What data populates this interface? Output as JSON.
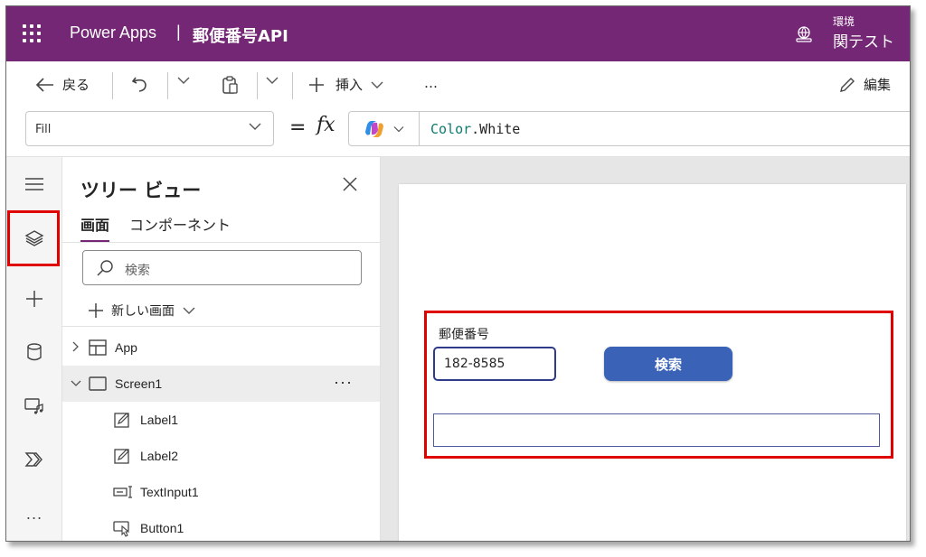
{
  "header": {
    "app_name": "Power Apps",
    "separator": "|",
    "app_title": "郵便番号API",
    "env_label": "環境",
    "env_name": "関テスト",
    "bg_color": "#742774"
  },
  "toolbar": {
    "back_label": "戻る",
    "insert_label": "挿入",
    "more_label": "…",
    "edit_label": "編集"
  },
  "formula_bar": {
    "property": "Fill",
    "equals": "=",
    "fx": "fx",
    "formula_object": "Color",
    "formula_dot_prop": ".White"
  },
  "rail": {
    "items": [
      "hamburger-icon",
      "layers-icon",
      "plus-icon",
      "database-icon",
      "media-icon",
      "power-automate-icon",
      "more-icon"
    ],
    "more_label": "..."
  },
  "tree_view": {
    "title": "ツリー ビュー",
    "tabs": [
      "画面",
      "コンポーネント"
    ],
    "search_placeholder": "検索",
    "new_screen_label": "新しい画面",
    "nodes": [
      {
        "label": "App",
        "icon": "app-icon"
      },
      {
        "label": "Screen1",
        "icon": "screen-icon",
        "more": "···"
      },
      {
        "label": "Label1",
        "icon": "label-icon"
      },
      {
        "label": "Label2",
        "icon": "label-icon"
      },
      {
        "label": "TextInput1",
        "icon": "textinput-icon"
      },
      {
        "label": "Button1",
        "icon": "button-icon"
      }
    ]
  },
  "canvas": {
    "label1_text": "郵便番号",
    "textinput_value": "182-8585",
    "button_text": "検索",
    "label2_text": "",
    "button_color": "#3a63b8",
    "highlight_color": "#e00000"
  }
}
